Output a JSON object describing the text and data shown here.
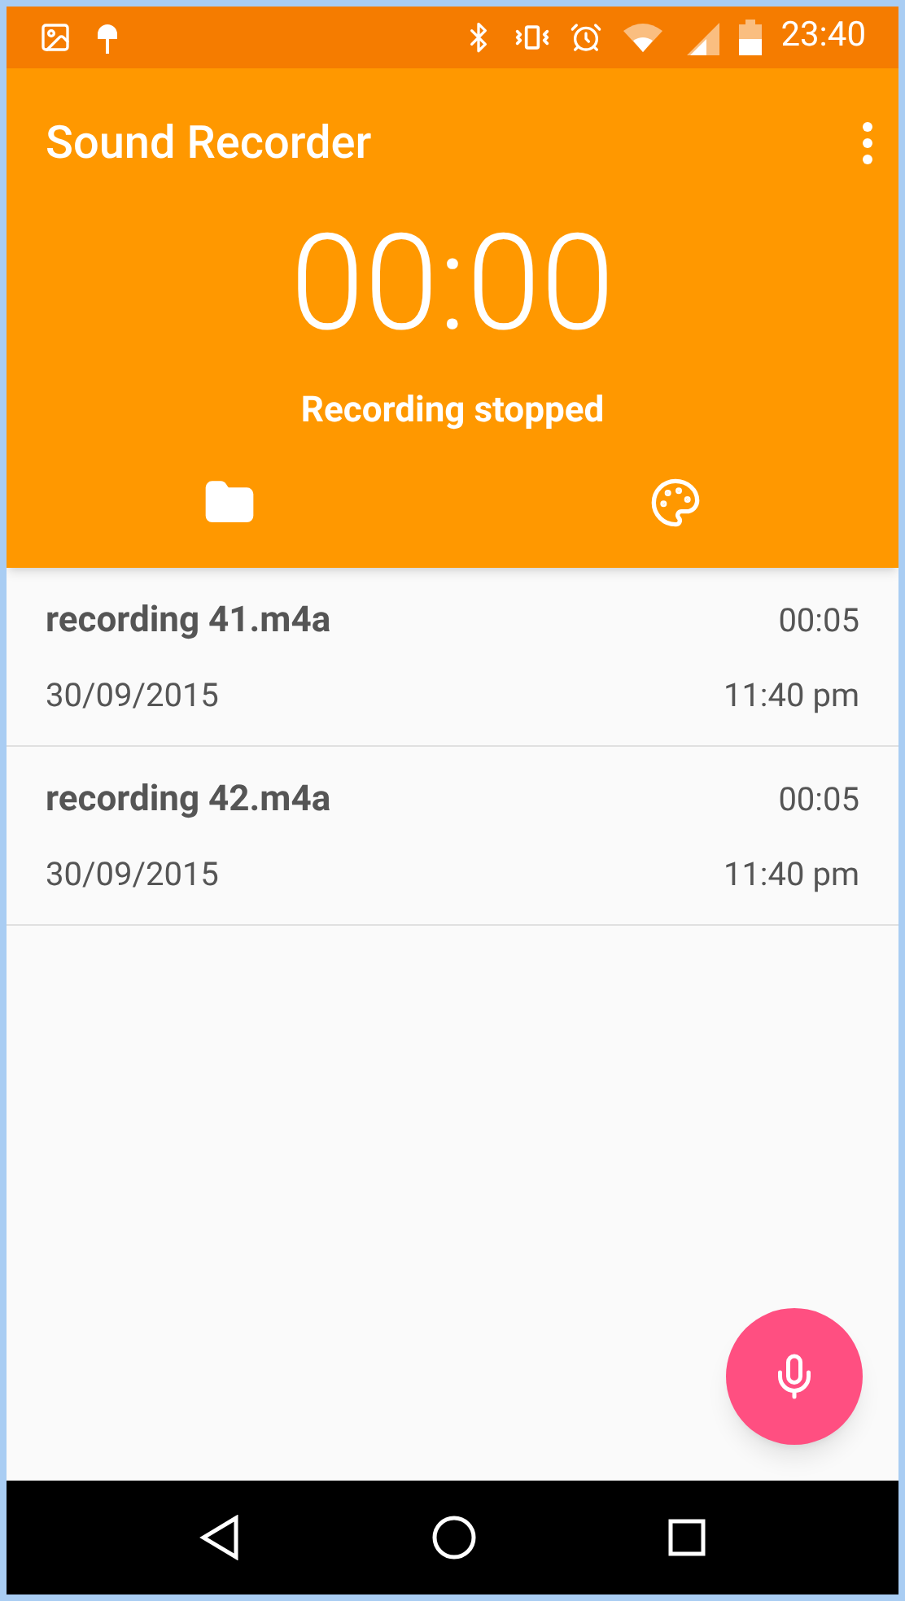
{
  "status_bar": {
    "time": "23:40"
  },
  "app_bar": {
    "title": "Sound Recorder"
  },
  "timer": {
    "elapsed": "00:00",
    "status": "Recording stopped"
  },
  "recordings": [
    {
      "name": "recording 41.m4a",
      "duration": "00:05",
      "date": "30/09/2015",
      "time": "11:40 pm"
    },
    {
      "name": "recording 42.m4a",
      "duration": "00:05",
      "date": "30/09/2015",
      "time": "11:40 pm"
    }
  ]
}
